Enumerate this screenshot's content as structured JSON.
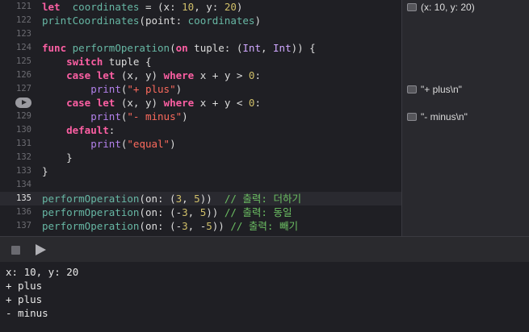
{
  "editor": {
    "lines": [
      {
        "num": "121",
        "segs": [
          [
            "kw",
            "let"
          ],
          [
            "",
            "  "
          ],
          [
            "fn",
            "coordinates"
          ],
          [
            "",
            " = (x: "
          ],
          [
            "num",
            "10"
          ],
          [
            "",
            ", y: "
          ],
          [
            "num",
            "20"
          ],
          [
            "",
            ")"
          ]
        ]
      },
      {
        "num": "122",
        "segs": [
          [
            "fn",
            "printCoordinates"
          ],
          [
            "",
            "(point: "
          ],
          [
            "fn",
            "coordinates"
          ],
          [
            "",
            ")"
          ]
        ]
      },
      {
        "num": "123",
        "segs": []
      },
      {
        "num": "124",
        "segs": [
          [
            "kw",
            "func"
          ],
          [
            "",
            " "
          ],
          [
            "fn",
            "performOperation"
          ],
          [
            "",
            "("
          ],
          [
            "kw",
            "on"
          ],
          [
            "",
            " tuple: ("
          ],
          [
            "ty",
            "Int"
          ],
          [
            "",
            ", "
          ],
          [
            "ty",
            "Int"
          ],
          [
            "",
            ")) {"
          ]
        ]
      },
      {
        "num": "125",
        "segs": [
          [
            "",
            "    "
          ],
          [
            "kw",
            "switch"
          ],
          [
            "",
            " tuple {"
          ]
        ]
      },
      {
        "num": "126",
        "segs": [
          [
            "",
            "    "
          ],
          [
            "kw",
            "case"
          ],
          [
            "",
            " "
          ],
          [
            "kw",
            "let"
          ],
          [
            "",
            " (x, y) "
          ],
          [
            "kw",
            "where"
          ],
          [
            "",
            " x + y > "
          ],
          [
            "num",
            "0"
          ],
          [
            "",
            ":"
          ]
        ]
      },
      {
        "num": "127",
        "segs": [
          [
            "",
            "        "
          ],
          [
            "call",
            "print"
          ],
          [
            "",
            "("
          ],
          [
            "str",
            "\"+ plus\""
          ],
          [
            "",
            ")"
          ]
        ]
      },
      {
        "num": "",
        "segs": [
          [
            "",
            "    "
          ],
          [
            "kw",
            "case"
          ],
          [
            "",
            " "
          ],
          [
            "kw",
            "let"
          ],
          [
            "",
            " (x, y) "
          ],
          [
            "kw",
            "where"
          ],
          [
            "",
            " x + y < "
          ],
          [
            "num",
            "0"
          ],
          [
            "",
            ":"
          ]
        ]
      },
      {
        "num": "129",
        "segs": [
          [
            "",
            "        "
          ],
          [
            "call",
            "print"
          ],
          [
            "",
            "("
          ],
          [
            "str",
            "\"- minus\""
          ],
          [
            "",
            ")"
          ]
        ]
      },
      {
        "num": "130",
        "segs": [
          [
            "",
            "    "
          ],
          [
            "kw",
            "default"
          ],
          [
            "",
            ":"
          ]
        ]
      },
      {
        "num": "131",
        "segs": [
          [
            "",
            "        "
          ],
          [
            "call",
            "print"
          ],
          [
            "",
            "("
          ],
          [
            "str",
            "\"equal\""
          ],
          [
            "",
            ")"
          ]
        ]
      },
      {
        "num": "132",
        "segs": [
          [
            "",
            "    }"
          ]
        ]
      },
      {
        "num": "133",
        "segs": [
          [
            "",
            "}"
          ]
        ]
      },
      {
        "num": "134",
        "segs": []
      },
      {
        "num": "135",
        "active": true,
        "segs": [
          [
            "fn",
            "performOperation"
          ],
          [
            "",
            "(on: ("
          ],
          [
            "num",
            "3"
          ],
          [
            "",
            ", "
          ],
          [
            "num",
            "5"
          ],
          [
            "",
            "))  "
          ],
          [
            "cm",
            "// 출력: 더하기"
          ]
        ]
      },
      {
        "num": "136",
        "segs": [
          [
            "fn",
            "performOperation"
          ],
          [
            "",
            "(on: (-"
          ],
          [
            "num",
            "3"
          ],
          [
            "",
            ", "
          ],
          [
            "num",
            "5"
          ],
          [
            "",
            ")) "
          ],
          [
            "cm",
            "// 출력: 동일"
          ]
        ]
      },
      {
        "num": "137",
        "segs": [
          [
            "fn",
            "performOperation"
          ],
          [
            "",
            "(on: (-"
          ],
          [
            "num",
            "3"
          ],
          [
            "",
            ", -"
          ],
          [
            "num",
            "5"
          ],
          [
            "",
            ")) "
          ],
          [
            "cm",
            "// 출력: 빼기"
          ]
        ]
      }
    ]
  },
  "results": [
    {
      "text": "(x: 10, y: 20)",
      "line": 0
    },
    {
      "text": "\"+ plus\\n\"",
      "line": 6
    },
    {
      "text": "\"- minus\\n\"",
      "line": 8
    }
  ],
  "toolbar": {
    "stop": "stop-icon",
    "play": "play-icon"
  },
  "console": {
    "lines": [
      "x: 10, y: 20",
      "+ plus",
      "+ plus",
      "- minus"
    ]
  }
}
